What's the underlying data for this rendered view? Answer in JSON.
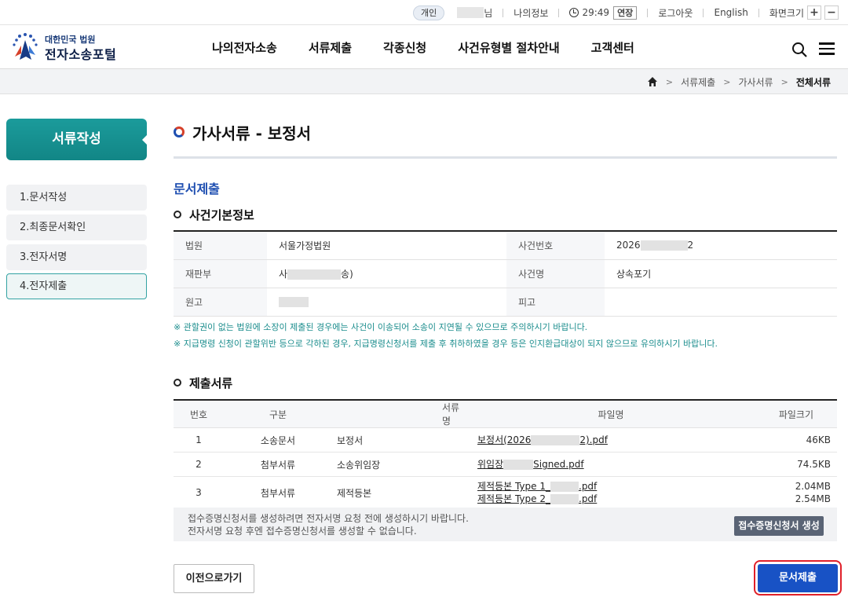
{
  "utility": {
    "user_type": "개인",
    "user_suffix": "님",
    "my_info": "나의정보",
    "timer": "29:49",
    "extend": "연장",
    "logout": "로그아웃",
    "english": "English",
    "zoom_label": "화면크기",
    "zoom_in": "+",
    "zoom_out": "−"
  },
  "logo": {
    "small": "대한민국 법원",
    "big": "전자소송포털"
  },
  "nav": [
    "나의전자소송",
    "서류제출",
    "각종신청",
    "사건유형별 절차안내",
    "고객센터"
  ],
  "breadcrumb": [
    "서류제출",
    "가사서류",
    "전체서류"
  ],
  "sidebar": {
    "title": "서류작성",
    "steps": [
      "1.문서작성",
      "2.최종문서확인",
      "3.전자서명",
      "4.전자제출"
    ]
  },
  "page": {
    "title": "가사서류 - 보정서",
    "section": "문서제출"
  },
  "case_info": {
    "heading": "사건기본정보",
    "court_label": "법원",
    "court": "서울가정법원",
    "case_no_label": "사건번호",
    "case_no_prefix": "2026",
    "case_no_suffix": "2",
    "division_label": "재판부",
    "division_prefix": "사",
    "division_suffix": "송)",
    "case_name_label": "사건명",
    "case_name": "상속포기",
    "plaintiff_label": "원고",
    "defendant_label": "피고"
  },
  "notices": [
    "※ 관할권이 없는 법원에 소장이 제출된 경우에는 사건이 이송되어 소송이 지연될 수 있으므로 주의하시기 바랍니다.",
    "※ 지급명령 신청이 관할위반 등으로 각하된 경우, 지급명령신청서를 제출 후 취하하였을 경우 등은 인지환급대상이 되지 않으므로 유의하시기 바랍니다."
  ],
  "documents": {
    "heading": "제출서류",
    "columns": [
      "번호",
      "구분",
      "서류명",
      "파일명",
      "파일크기"
    ],
    "rows": [
      {
        "no": "1",
        "type": "소송문서",
        "name": "보정서",
        "files": [
          {
            "pre": "보정서(2026",
            "post": "2).pdf",
            "size": "46KB"
          }
        ]
      },
      {
        "no": "2",
        "type": "첨부서류",
        "name": "소송위임장",
        "files": [
          {
            "pre": "위임장",
            "post": "Signed.pdf",
            "size": "74.5KB"
          }
        ]
      },
      {
        "no": "3",
        "type": "첨부서류",
        "name": "제적등본",
        "files": [
          {
            "pre": "제적등본 Type 1_",
            "post": ".pdf",
            "size": "2.04MB"
          },
          {
            "pre": "제적등본 Type 2_",
            "post": ".pdf",
            "size": "2.54MB"
          }
        ]
      }
    ]
  },
  "receipt": {
    "line1": "접수증명신청서를 생성하려면 전자서명 요청 전에 생성하시기 바랍니다.",
    "line2": "전자서명 요청 후엔 접수증명신청서를 생성할 수 없습니다.",
    "button": "접수증명신청서 생성"
  },
  "actions": {
    "prev": "이전으로가기",
    "submit": "문서제출"
  }
}
